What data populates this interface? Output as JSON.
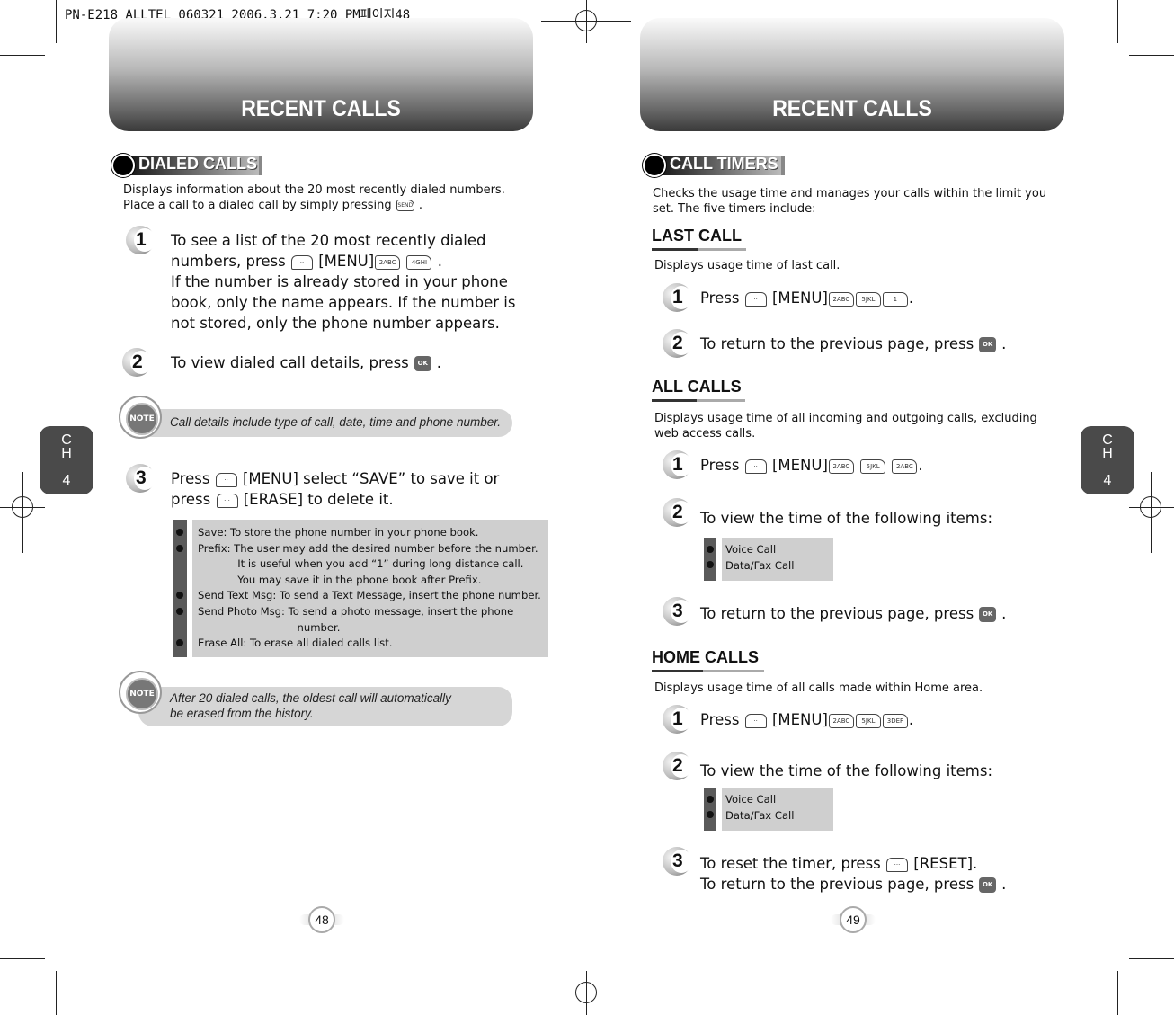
{
  "print_header": "PN-E218_ALLTEL_060321  2006.3.21 7:20 PM페이지48",
  "left_page": {
    "banner_title": "RECENT CALLS",
    "section_title": "DIALED CALLS",
    "intro_line1": "Displays information about the 20 most recently dialed numbers.",
    "intro_line2": "Place a call to a dialed call by simply pressing",
    "intro_end": ".",
    "step1": {
      "number": "1",
      "line1": "To see a list of the 20 most recently dialed",
      "line2_a": "numbers, press",
      "line2_b": "[MENU]",
      "line2_end": ".",
      "keys": [
        "2ABC",
        "4GHI"
      ],
      "line3": "If the number is already stored in your phone",
      "line4": "book, only the name appears. If the number is",
      "line5": "not stored, only the phone number appears."
    },
    "step2": {
      "number": "2",
      "text": "To view dialed call details, press",
      "end": "."
    },
    "note1": "Call details include type of call, date, time and phone number.",
    "step3": {
      "number": "3",
      "line1_a": "Press",
      "line1_b": "[MENU] select “SAVE” to save it or",
      "line2_a": "press",
      "line2_b": "[ERASE] to delete it."
    },
    "options": [
      "Save: To store the phone number in your phone book.",
      "Prefix: The user may add the desired number before the number.",
      "            It is useful when you add “1” during long distance call.",
      "            You may save it in the phone book after Prefix.",
      "Send Text Msg: To send a Text Message, insert the phone number.",
      "Send Photo Msg: To send a photo message, insert the phone",
      "                              number.",
      "Erase All: To erase all dialed calls list."
    ],
    "note2_line1": "After 20 dialed calls, the oldest call will automatically",
    "note2_line2": "be erased from the history.",
    "page_number": "48",
    "chapter_c": "C",
    "chapter_h": "H",
    "chapter_num": "4"
  },
  "right_page": {
    "banner_title": "RECENT CALLS",
    "section_title": "CALL TIMERS",
    "intro_line1": "Checks the usage time and manages your calls within the limit you",
    "intro_line2": "set. The five timers include:",
    "last_call": {
      "title": "LAST CALL",
      "desc": "Displays usage time of last call.",
      "step1_a": "Press",
      "step1_b": "[MENU]",
      "step1_end": ".",
      "keys": [
        "2ABC",
        "5JKL",
        "1"
      ],
      "step2": "To return to the previous page, press",
      "step2_end": "."
    },
    "all_calls": {
      "title": "ALL CALLS",
      "desc_line1": "Displays usage time of all incoming and outgoing calls, excluding",
      "desc_line2": "web access calls.",
      "step1_a": "Press",
      "step1_b": "[MENU]",
      "step1_end": ".",
      "keys": [
        "2ABC",
        "5JKL",
        "2ABC"
      ],
      "step2": "To view the time of the following items:",
      "items": [
        "Voice Call",
        "Data/Fax Call"
      ],
      "step3": "To return to the previous page, press",
      "step3_end": "."
    },
    "home_calls": {
      "title": "HOME CALLS",
      "desc": "Displays usage time of all calls made within Home area.",
      "step1_a": "Press",
      "step1_b": "[MENU]",
      "step1_end": ".",
      "keys": [
        "2ABC",
        "5JKL",
        "3DEF"
      ],
      "step2": "To view the time of the following items:",
      "items": [
        "Voice Call",
        "Data/Fax Call"
      ],
      "step3_line1_a": "To reset the timer, press",
      "step3_line1_b": "[RESET].",
      "step3_line2": "To return to the previous page, press",
      "step3_end": "."
    },
    "page_number": "49",
    "chapter_c": "C",
    "chapter_h": "H",
    "chapter_num": "4"
  },
  "icons": {
    "ok": "OK",
    "soft_left": "··",
    "soft_right": "···",
    "send": "SEND",
    "note": "NOTE"
  }
}
